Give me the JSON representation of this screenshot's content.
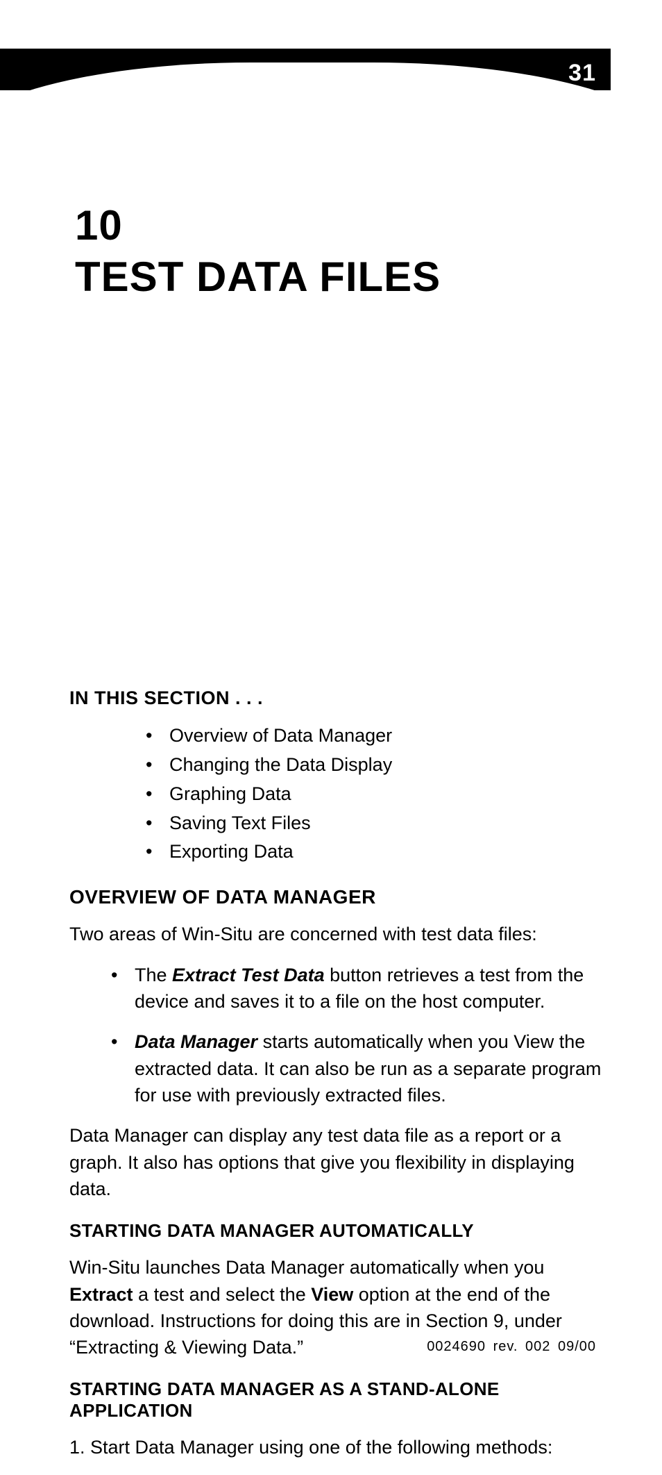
{
  "page_number": "31",
  "chapter": {
    "number": "10",
    "title": "TEST DATA FILES"
  },
  "section_label": "IN THIS SECTION . . .",
  "toc": [
    "Overview of Data Manager",
    "Changing the Data Display",
    "Graphing Data",
    "Saving Text Files",
    "Exporting Data"
  ],
  "overview": {
    "heading": "OVERVIEW OF DATA MANAGER",
    "intro": "Two areas of Win-Situ are concerned with test data files:",
    "bullets": [
      {
        "lead_bold_italic": "Extract Test Data",
        "prefix": "The ",
        "rest": " button retrieves a test from the device and saves it to a file on the host computer."
      },
      {
        "lead_bold_italic": "Data Manager",
        "prefix": "",
        "rest": " starts automatically when you View the extracted data. It can also be run as a separate program for use with previously extracted files."
      }
    ],
    "outro": "Data Manager can display any test data file as a report or a graph. It also has options that give you flexibility in displaying data."
  },
  "auto": {
    "heading": "STARTING DATA MANAGER AUTOMATICALLY",
    "p_pre1": "Win-Situ launches Data Manager automatically when you ",
    "bold1": "Extract",
    "p_mid1": " a test and select the ",
    "bold2": "View",
    "p_post1": " option at the end of the download. Instructions for doing this are in Section 9, under “Extracting & Viewing Data.”"
  },
  "standalone": {
    "heading": "STARTING DATA MANAGER AS A STAND-ALONE APPLICATION",
    "step1": "1.  Start Data Manager using one of the following methods:"
  },
  "footer": "0024690 rev. 002   09/00"
}
